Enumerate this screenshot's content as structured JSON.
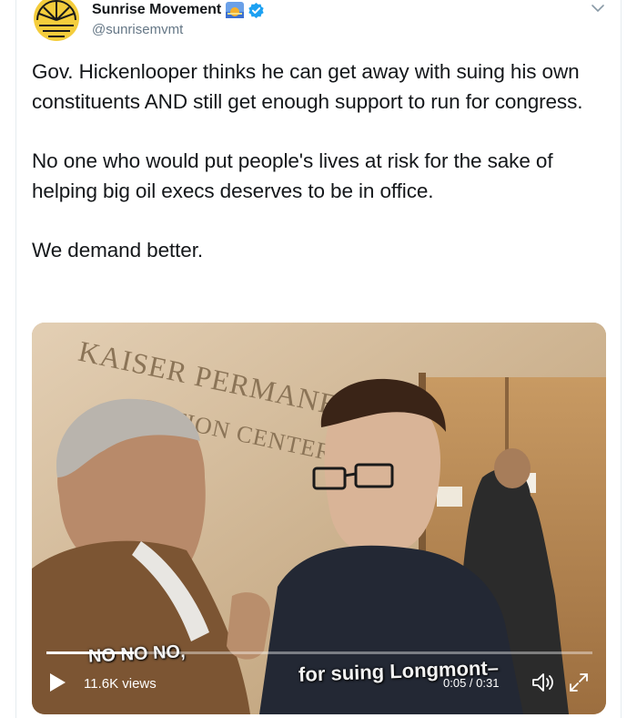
{
  "author": {
    "display_name": "Sunrise Movement",
    "handle": "@sunrisemvmt",
    "avatar_icon": "sun-logo-icon",
    "badge_icon": "sunrise-emoji-icon",
    "verified_icon": "verified-badge-icon",
    "brand_color": "#f4cd3c",
    "verified_color": "#1da1f2"
  },
  "menu": {
    "icon": "chevron-down-icon"
  },
  "tweet": {
    "paragraphs": [
      "Gov. Hickenlooper thinks he can get away with suing his own constituents AND still get enough support to run for congress.",
      "No one who would put people's lives at risk for the sake of helping big oil execs deserves to be in office.",
      "We demand better."
    ]
  },
  "video": {
    "sign_line1": "KAISER PERMANENTE",
    "sign_line2": "ATION CENTER",
    "caption_left": "NO NO NO,",
    "caption_right": "for suing Longmont–",
    "views": "11.6K views",
    "time": "0:05 / 0:31",
    "progress_fraction": 0.16,
    "play_icon": "play-icon",
    "volume_icon": "volume-icon",
    "fullscreen_icon": "fullscreen-icon"
  }
}
